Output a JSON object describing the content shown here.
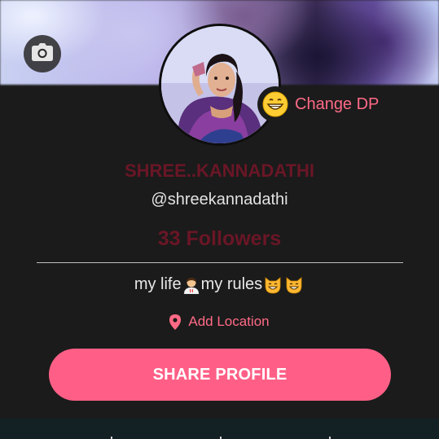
{
  "header": {
    "cover_photo": "blurred-cover-photo",
    "camera_icon": "camera-icon"
  },
  "profile": {
    "avatar": "profile-photo",
    "change_dp_icon": "grinning-face-emoji",
    "change_dp_label": "Change DP",
    "display_name": "SHREE..KANNADATHI",
    "username": "@shreekannadathi",
    "followers": "33 Followers",
    "bio": {
      "text_1": "my life",
      "emoji_1": "woman-health-worker-emoji",
      "text_2": "my rules",
      "emoji_2": "grinning-cat-emoji",
      "emoji_3": "grinning-cat-emoji"
    },
    "location_icon": "location-pin-icon",
    "location_label": "Add Location"
  },
  "actions": {
    "share_label": "SHARE PROFILE"
  },
  "colors": {
    "accent": "#ff5f86",
    "accent_text": "#ff6a86",
    "name_color": "#6a1626",
    "background": "#1b1b1b"
  }
}
